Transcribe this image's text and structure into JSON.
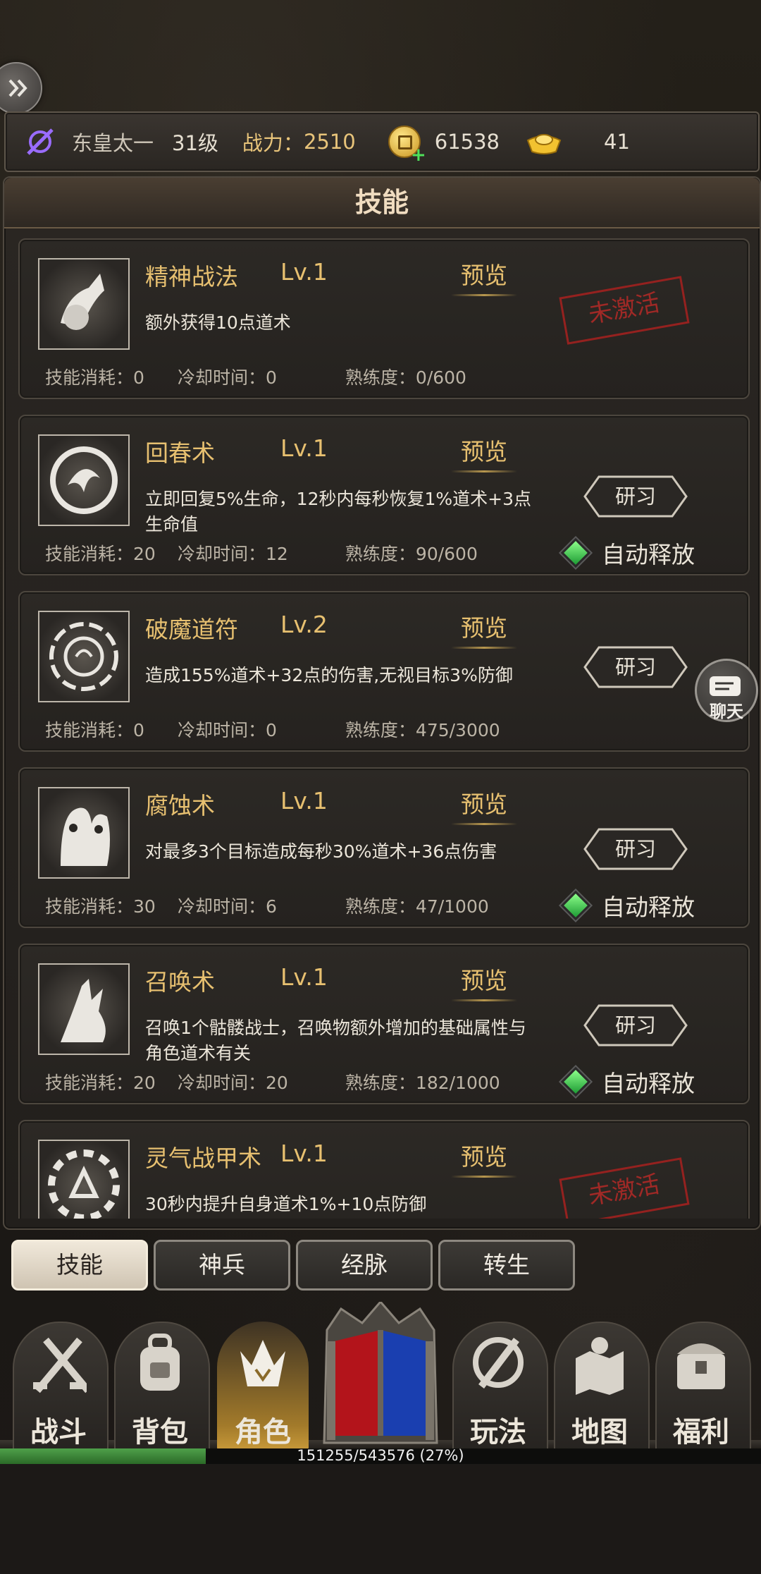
{
  "player": {
    "name": "东皇太一",
    "level": "31级",
    "power_label": "战力：",
    "power": "2510",
    "gold": "61538",
    "ingots": "41"
  },
  "panel_title": "技能",
  "labels": {
    "preview": "预览",
    "learn": "研习",
    "auto_cast": "自动释放",
    "inactive": "未激活",
    "cost_prefix": "技能消耗：",
    "cooldown_prefix": "冷却时间：",
    "proficiency_prefix": "熟练度："
  },
  "skills": [
    {
      "name": "精神战法",
      "level": "Lv.1",
      "desc": "额外获得10点道术",
      "cost": "0",
      "cooldown": "0",
      "proficiency": "0/600",
      "state": "inactive"
    },
    {
      "name": "回春术",
      "level": "Lv.1",
      "desc": "立即回复5%生命，12秒内每秒恢复1%道术+3点生命值",
      "cost": "20",
      "cooldown": "12",
      "proficiency": "90/600",
      "state": "learn_auto"
    },
    {
      "name": "破魔道符",
      "level": "Lv.2",
      "desc": "造成155%道术+32点的伤害,无视目标3%防御",
      "cost": "0",
      "cooldown": "0",
      "proficiency": "475/3000",
      "state": "learn"
    },
    {
      "name": "腐蚀术",
      "level": "Lv.1",
      "desc": "对最多3个目标造成每秒30%道术+36点伤害",
      "cost": "30",
      "cooldown": "6",
      "proficiency": "47/1000",
      "state": "learn_auto"
    },
    {
      "name": "召唤术",
      "level": "Lv.1",
      "desc": "召唤1个骷髅战士，召唤物额外增加的基础属性与角色道术有关",
      "cost": "20",
      "cooldown": "20",
      "proficiency": "182/1000",
      "state": "learn_auto"
    },
    {
      "name": "灵气战甲术",
      "level": "Lv.1",
      "desc": "30秒内提升自身道术1%+10点防御",
      "cost": "",
      "cooldown": "",
      "proficiency": "",
      "state": "inactive"
    }
  ],
  "chat_label": "聊天",
  "tabs": [
    {
      "label": "技能",
      "active": true
    },
    {
      "label": "神兵",
      "active": false
    },
    {
      "label": "经脉",
      "active": false
    },
    {
      "label": "转生",
      "active": false
    }
  ],
  "nav": [
    {
      "label": "战斗",
      "icon": "swords-icon"
    },
    {
      "label": "背包",
      "icon": "backpack-icon"
    },
    {
      "label": "角色",
      "icon": "crown-icon",
      "active": true
    },
    {
      "label": "玩法",
      "icon": "sword-swirl-icon"
    },
    {
      "label": "地图",
      "icon": "map-icon"
    },
    {
      "label": "福利",
      "icon": "chest-icon"
    }
  ],
  "exp": {
    "text": "151255/543576 (27%)",
    "fraction": 0.27
  },
  "colors": {
    "accent_gold": "#e7c070",
    "stamp_red": "#b52a27",
    "exp_green": "#4fa04a"
  }
}
